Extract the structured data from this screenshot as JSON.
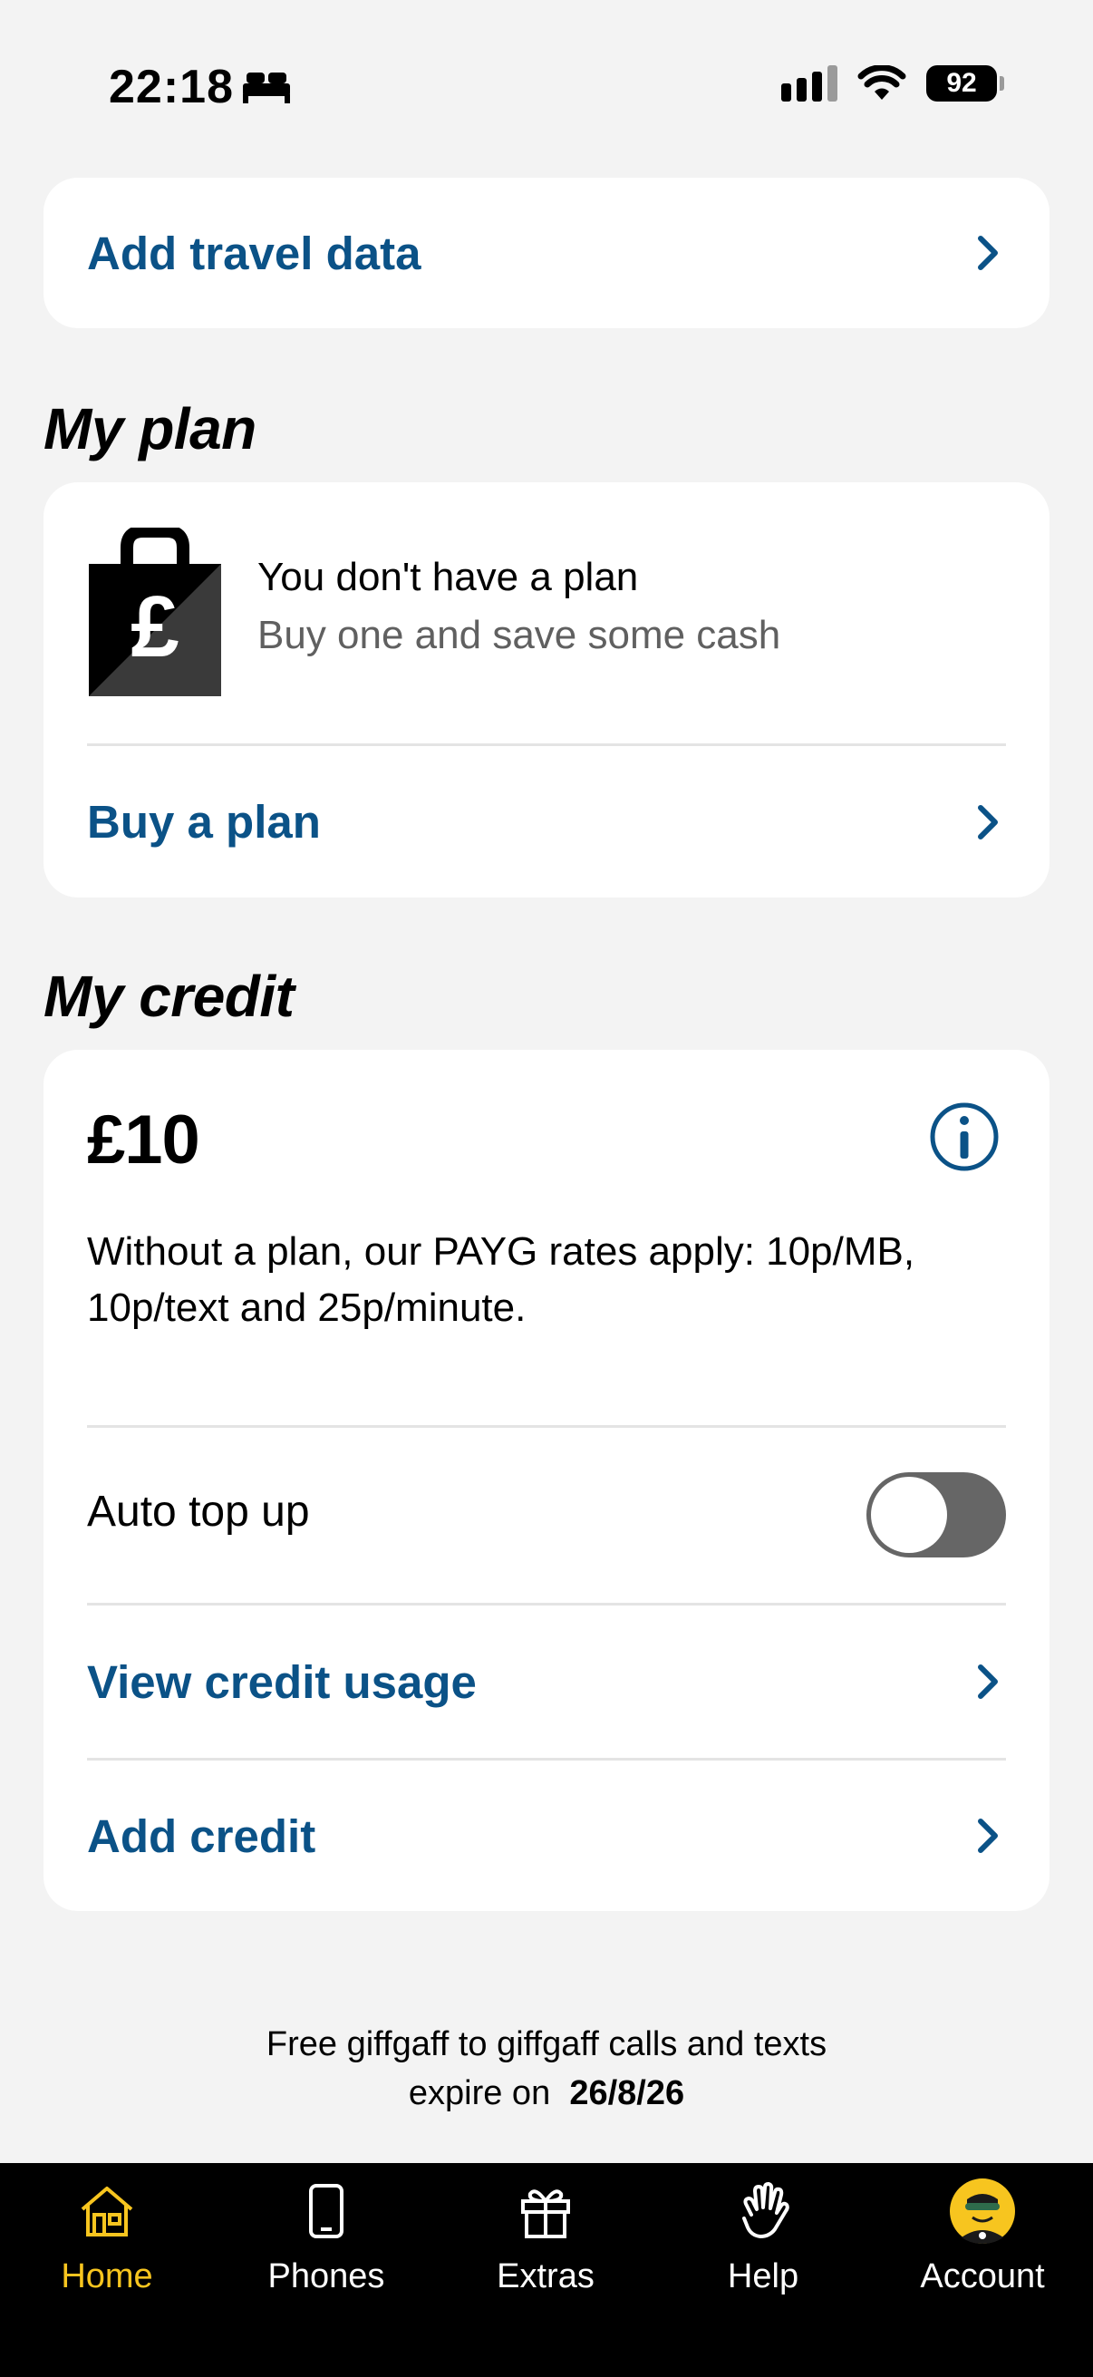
{
  "status_bar": {
    "time": "22:18",
    "battery": "92"
  },
  "travel": {
    "label": "Add travel data"
  },
  "my_plan": {
    "title": "My plan",
    "headline": "You don't have a plan",
    "subline": "Buy one and save some cash",
    "buy_label": "Buy a plan"
  },
  "my_credit": {
    "title": "My credit",
    "amount": "£10",
    "description": "Without a plan, our PAYG rates apply: 10p/MB, 10p/text and 25p/minute.",
    "auto_top_up_label": "Auto top up",
    "auto_top_up_on": false,
    "view_usage_label": "View credit usage",
    "add_credit_label": "Add credit"
  },
  "footer": {
    "line1": "Free giffgaff to giffgaff calls and texts",
    "line2_prefix": "expire on",
    "expiry_date": "26/8/26"
  },
  "tabs": [
    {
      "label": "Home",
      "icon": "home-icon",
      "active": true
    },
    {
      "label": "Phones",
      "icon": "phone-icon",
      "active": false
    },
    {
      "label": "Extras",
      "icon": "gift-icon",
      "active": false
    },
    {
      "label": "Help",
      "icon": "hand-icon",
      "active": false
    },
    {
      "label": "Account",
      "icon": "avatar-icon",
      "active": false
    }
  ],
  "colors": {
    "link": "#0b5287",
    "accent": "#f7c51f",
    "background": "#f3f3f3",
    "tab_bar": "#000000"
  }
}
